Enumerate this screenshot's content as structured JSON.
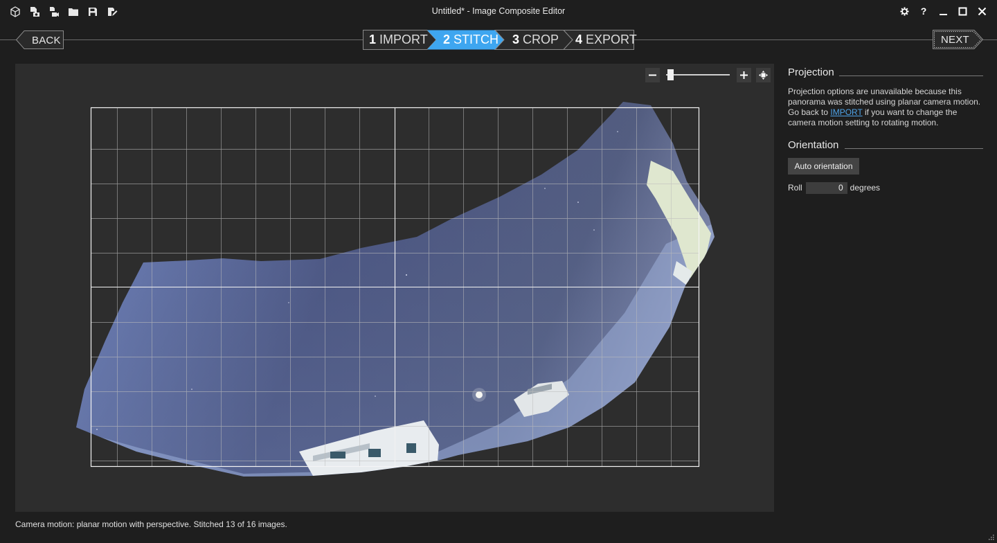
{
  "window": {
    "title": "Untitled* - Image Composite Editor",
    "toolbar_icons": [
      "new-project-icon",
      "new-panorama-from-images-icon",
      "new-panorama-from-video-icon",
      "open-project-icon",
      "save-icon",
      "save-as-icon"
    ],
    "controls": [
      "settings-icon",
      "help-icon",
      "minimize-icon",
      "maximize-icon",
      "close-icon"
    ],
    "help_label": "?"
  },
  "nav": {
    "back_label": "BACK",
    "next_label": "NEXT",
    "steps": [
      {
        "number": "1",
        "label": "IMPORT",
        "active": false
      },
      {
        "number": "2",
        "label": "STITCH",
        "active": true
      },
      {
        "number": "3",
        "label": "CROP",
        "active": false
      },
      {
        "number": "4",
        "label": "EXPORT",
        "active": false
      }
    ]
  },
  "zoom": {
    "level": 0.03,
    "icons": [
      "zoom-out-icon",
      "zoom-in-icon",
      "fit-to-window-icon"
    ]
  },
  "panel": {
    "projection": {
      "title": "Projection",
      "text_before_link": "Projection options are unavailable because this panorama was stitched using planar camera motion. Go back to ",
      "link": "IMPORT",
      "text_after_link": " if you want to change the camera motion setting to rotating motion."
    },
    "orientation": {
      "title": "Orientation",
      "auto_button": "Auto orientation",
      "roll_label": "Roll",
      "roll_value": "0",
      "roll_unit": "degrees"
    }
  },
  "status": "Camera motion: planar motion with perspective. Stitched 13 of 16 images.",
  "colors": {
    "accent": "#3ea6f0",
    "background": "#1e1e1e",
    "canvas": "#2d2d2d",
    "link": "#4fa3e8"
  }
}
